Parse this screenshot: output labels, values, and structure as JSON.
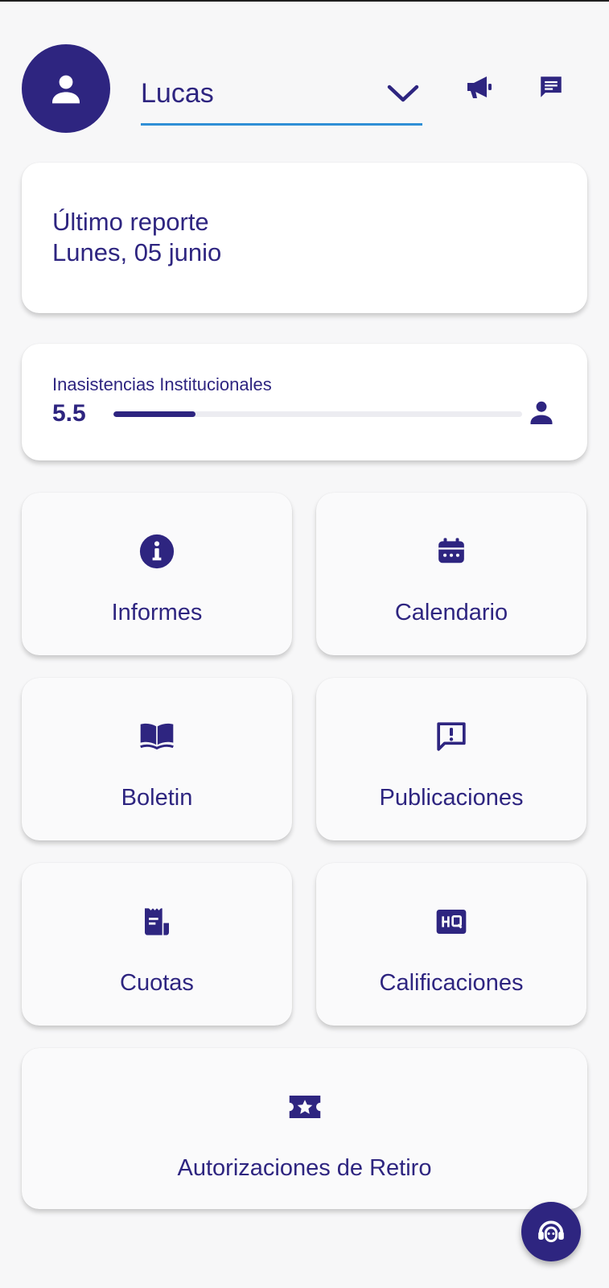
{
  "header": {
    "student_name": "Lucas"
  },
  "report": {
    "line1": "Último reporte",
    "line2": "Lunes, 05 junio"
  },
  "absences": {
    "label": "Inasistencias Institucionales",
    "value": "5.5",
    "progress_fraction": 0.2
  },
  "menu": {
    "informes": "Informes",
    "calendario": "Calendario",
    "boletin": "Boletin",
    "publicaciones": "Publicaciones",
    "cuotas": "Cuotas",
    "calificaciones": "Calificaciones",
    "autorizaciones": "Autorizaciones de Retiro"
  },
  "colors": {
    "primary": "#2e2580",
    "accent_underline": "#2f8fd6",
    "background": "#f7f7f8"
  }
}
